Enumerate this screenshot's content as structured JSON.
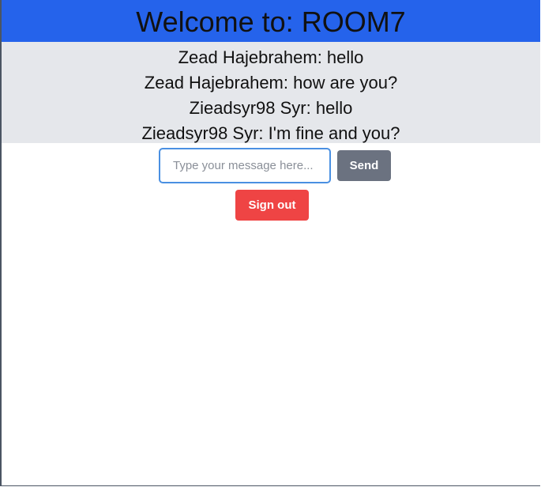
{
  "header": {
    "title": "Welcome to: ROOM7",
    "color": "#2563eb"
  },
  "messages": [
    {
      "text": "Zead Hajebrahem: hello"
    },
    {
      "text": "Zead Hajebrahem: how are you?"
    },
    {
      "text": "Zieadsyr98 Syr: hello"
    },
    {
      "text": "Zieadsyr98 Syr: I'm fine and you?"
    }
  ],
  "composer": {
    "input_value": "",
    "input_placeholder": "Type your message here...",
    "send_label": "Send"
  },
  "signout_label": "Sign out",
  "colors": {
    "messages_bg": "#e5e7eb",
    "send_button": "#6b7280",
    "signout_button": "#ef4444"
  }
}
